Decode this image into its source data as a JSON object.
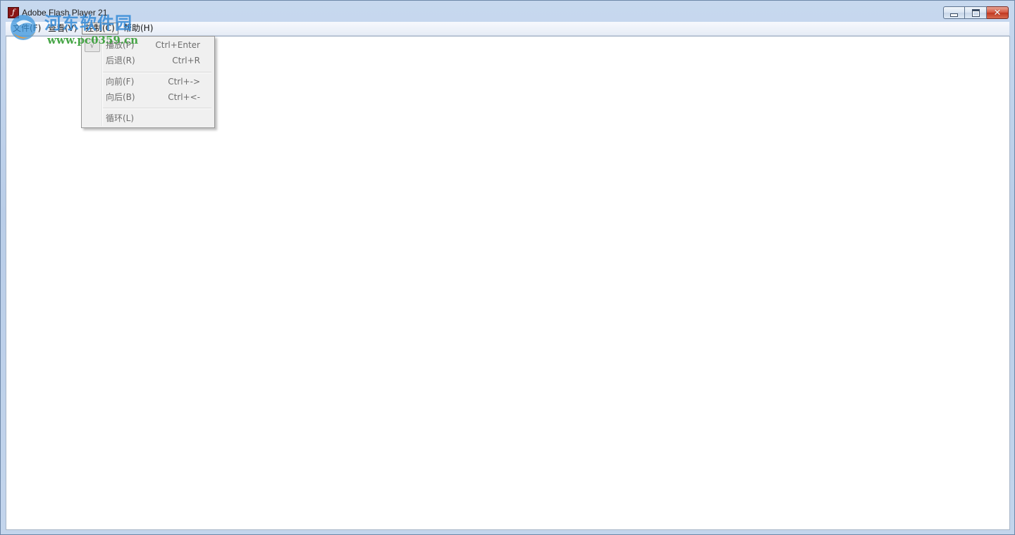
{
  "window": {
    "title": "Adobe Flash Player 21",
    "icon": "flash-player-icon",
    "caption_buttons": [
      "minimize-icon",
      "maximize-icon",
      "close-icon"
    ],
    "close_color": "#c13820"
  },
  "menubar": {
    "items": [
      {
        "label": "文件(F)"
      },
      {
        "label": "查看(V)"
      },
      {
        "label": "控制(C)",
        "active": true
      },
      {
        "label": "帮助(H)"
      }
    ]
  },
  "control_menu": {
    "items": [
      {
        "label": "播放(P)",
        "shortcut": "Ctrl+Enter",
        "checked": true,
        "enabled": false
      },
      {
        "label": "后退(R)",
        "shortcut": "Ctrl+R",
        "enabled": false
      },
      {
        "label": "向前(F)",
        "shortcut": "Ctrl+->",
        "enabled": false
      },
      {
        "label": "向后(B)",
        "shortcut": "Ctrl+<-",
        "enabled": false
      },
      {
        "label": "循环(L)",
        "shortcut": "",
        "enabled": false
      }
    ],
    "check_glyph": "√"
  },
  "watermark": {
    "title": "河东软件园",
    "url": "www.pc0359.cn"
  }
}
